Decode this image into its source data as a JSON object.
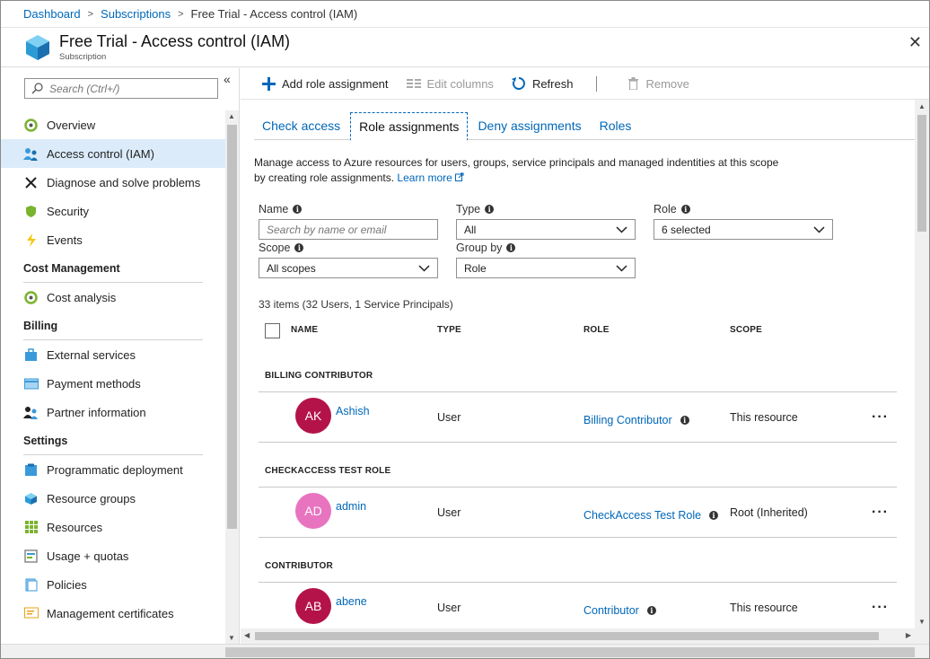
{
  "breadcrumb": {
    "items": [
      "Dashboard",
      "Subscriptions"
    ],
    "current": "Free Trial - Access control (IAM)",
    "separator": ">"
  },
  "header": {
    "title": "Free Trial - Access control (IAM)",
    "subtitle": "Subscription",
    "close": "✕"
  },
  "sidebar": {
    "collapse": "«",
    "search_placeholder": "Search (Ctrl+/)",
    "items": [
      {
        "label": "Overview",
        "icon": "overview-icon"
      },
      {
        "label": "Access control (IAM)",
        "icon": "people-icon",
        "active": true
      },
      {
        "label": "Diagnose and solve problems",
        "icon": "tools-icon"
      },
      {
        "label": "Security",
        "icon": "shield-icon"
      },
      {
        "label": "Events",
        "icon": "lightning-icon"
      }
    ],
    "sections": [
      {
        "title": "Cost Management",
        "items": [
          {
            "label": "Cost analysis",
            "icon": "cost-analysis-icon"
          }
        ]
      },
      {
        "title": "Billing",
        "items": [
          {
            "label": "External services",
            "icon": "bag-icon"
          },
          {
            "label": "Payment methods",
            "icon": "card-icon"
          },
          {
            "label": "Partner information",
            "icon": "partner-icon"
          }
        ]
      },
      {
        "title": "Settings",
        "items": [
          {
            "label": "Programmatic deployment",
            "icon": "deployment-icon"
          },
          {
            "label": "Resource groups",
            "icon": "cube-icon"
          },
          {
            "label": "Resources",
            "icon": "grid-icon"
          },
          {
            "label": "Usage + quotas",
            "icon": "quota-icon"
          },
          {
            "label": "Policies",
            "icon": "document-icon"
          },
          {
            "label": "Management certificates",
            "icon": "certificate-icon"
          }
        ]
      }
    ]
  },
  "toolbar": {
    "add": "Add role assignment",
    "edit_columns": "Edit columns",
    "refresh": "Refresh",
    "remove": "Remove"
  },
  "tabs": [
    "Check access",
    "Role assignments",
    "Deny assignments",
    "Roles"
  ],
  "active_tab": "Role assignments",
  "description": {
    "text": "Manage access to Azure resources for users, groups, service principals and managed indentities at this scope by creating role assignments.",
    "link": "Learn more"
  },
  "filters": {
    "name_label": "Name",
    "name_placeholder": "Search by name or email",
    "type_label": "Type",
    "type_value": "All",
    "role_label": "Role",
    "role_value": "6 selected",
    "scope_label": "Scope",
    "scope_value": "All scopes",
    "groupby_label": "Group by",
    "groupby_value": "Role"
  },
  "count": "33 items (32 Users, 1 Service Principals)",
  "table": {
    "headers": [
      "NAME",
      "TYPE",
      "ROLE",
      "SCOPE"
    ],
    "groups": [
      {
        "title": "BILLING CONTRIBUTOR",
        "rows": [
          {
            "initials": "AK",
            "name": "Ashish",
            "type": "User",
            "role": "Billing Contributor",
            "scope": "This resource",
            "avatar_color": "#b4134a"
          }
        ]
      },
      {
        "title": "CHECKACCESS TEST ROLE",
        "rows": [
          {
            "initials": "AD",
            "name": "admin",
            "type": "User",
            "role": "CheckAccess Test Role",
            "scope": "Root (Inherited)",
            "avatar_color": "#e874c0"
          }
        ]
      },
      {
        "title": "CONTRIBUTOR",
        "rows": [
          {
            "initials": "AB",
            "name": "abene",
            "type": "User",
            "role": "Contributor",
            "scope": "This resource",
            "avatar_color": "#b4134a"
          }
        ]
      }
    ],
    "more": "···"
  },
  "colors": {
    "link": "#0067b8",
    "active_nav": "#dbebf9"
  }
}
